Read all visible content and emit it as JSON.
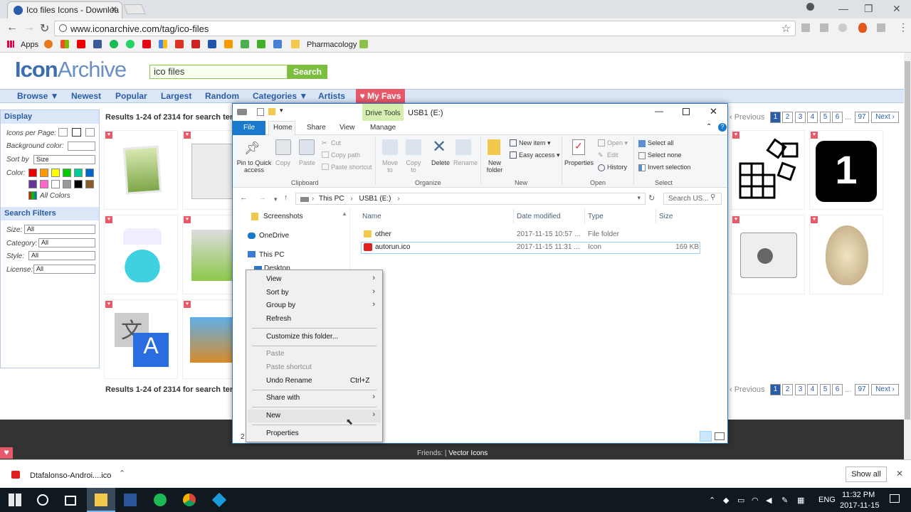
{
  "browser": {
    "tab_title": "Ico files Icons - Downloa",
    "url": "www.iconarchive.com/tag/ico-files",
    "bookmarks": {
      "apps": "Apps",
      "pharmacology": "Pharmacology"
    }
  },
  "site": {
    "logo_icon": "Icon",
    "logo_archive": "Archive",
    "search_value": "ico files",
    "search_button": "Search",
    "nav": [
      "Browse ▼",
      "Newest",
      "Popular",
      "Largest",
      "Random",
      "Categories ▼",
      "Artists"
    ],
    "my_favs": "♥ My Favs",
    "display": {
      "header": "Display",
      "icons_per_page": "Icons per Page:",
      "background_color": "Background color:",
      "sort_by": "Sort by",
      "sort_value": "Size",
      "color": "Color:",
      "all_colors": "All Colors"
    },
    "filters": {
      "header": "Search Filters",
      "size": "Size:",
      "category": "Category:",
      "style": "Style:",
      "license": "License:",
      "all": "All"
    },
    "results": "Results 1-24 of 2314 for search term",
    "pagination": {
      "previous": "‹ Previous",
      "pages": [
        "1",
        "2",
        "3",
        "4",
        "5",
        "6",
        "97"
      ],
      "next": "Next ›",
      "ellipsis": "..."
    },
    "friends": "Friends:",
    "friends_link": "Vector Icons"
  },
  "explorer": {
    "drive_tools": "Drive Tools",
    "title": "USB1 (E:)",
    "tabs": {
      "file": "File",
      "home": "Home",
      "share": "Share",
      "view": "View",
      "manage": "Manage"
    },
    "ribbon": {
      "pin": "Pin to Quick access",
      "copy": "Copy",
      "paste": "Paste",
      "cut": "Cut",
      "copy_path": "Copy path",
      "paste_shortcut": "Paste shortcut",
      "clipboard": "Clipboard",
      "move_to": "Move to",
      "copy_to": "Copy to",
      "delete": "Delete",
      "rename": "Rename",
      "organize": "Organize",
      "new_folder": "New folder",
      "new_item": "New item ▾",
      "easy_access": "Easy access ▾",
      "new": "New",
      "properties": "Properties",
      "open": "Open ▾",
      "edit": "Edit",
      "history": "History",
      "open_group": "Open",
      "select_all": "Select all",
      "select_none": "Select none",
      "invert_selection": "Invert selection",
      "select": "Select"
    },
    "breadcrumb": [
      "This PC",
      "USB1 (E:)"
    ],
    "search_placeholder": "Search US...",
    "nav_tree": [
      "Screenshots",
      "OneDrive",
      "This PC",
      "Desktop"
    ],
    "columns": {
      "name": "Name",
      "date": "Date modified",
      "type": "Type",
      "size": "Size"
    },
    "files": [
      {
        "name": "other",
        "date": "2017-11-15 10:57 ...",
        "type": "File folder",
        "size": ""
      },
      {
        "name": "autorun.ico",
        "date": "2017-11-15 11:31 ...",
        "type": "Icon",
        "size": "169 KB"
      }
    ],
    "status": "2"
  },
  "context_menu": {
    "view": "View",
    "sort_by": "Sort by",
    "group_by": "Group by",
    "refresh": "Refresh",
    "customize": "Customize this folder...",
    "paste": "Paste",
    "paste_shortcut": "Paste shortcut",
    "undo_rename": "Undo Rename",
    "undo_shortcut": "Ctrl+Z",
    "share_with": "Share with",
    "new": "New",
    "properties": "Properties"
  },
  "downloads": {
    "file": "Dtafalonso-Androi....ico",
    "show_all": "Show all"
  },
  "taskbar": {
    "time": "11:32 PM",
    "date": "2017-11-15",
    "lang": "ENG"
  }
}
